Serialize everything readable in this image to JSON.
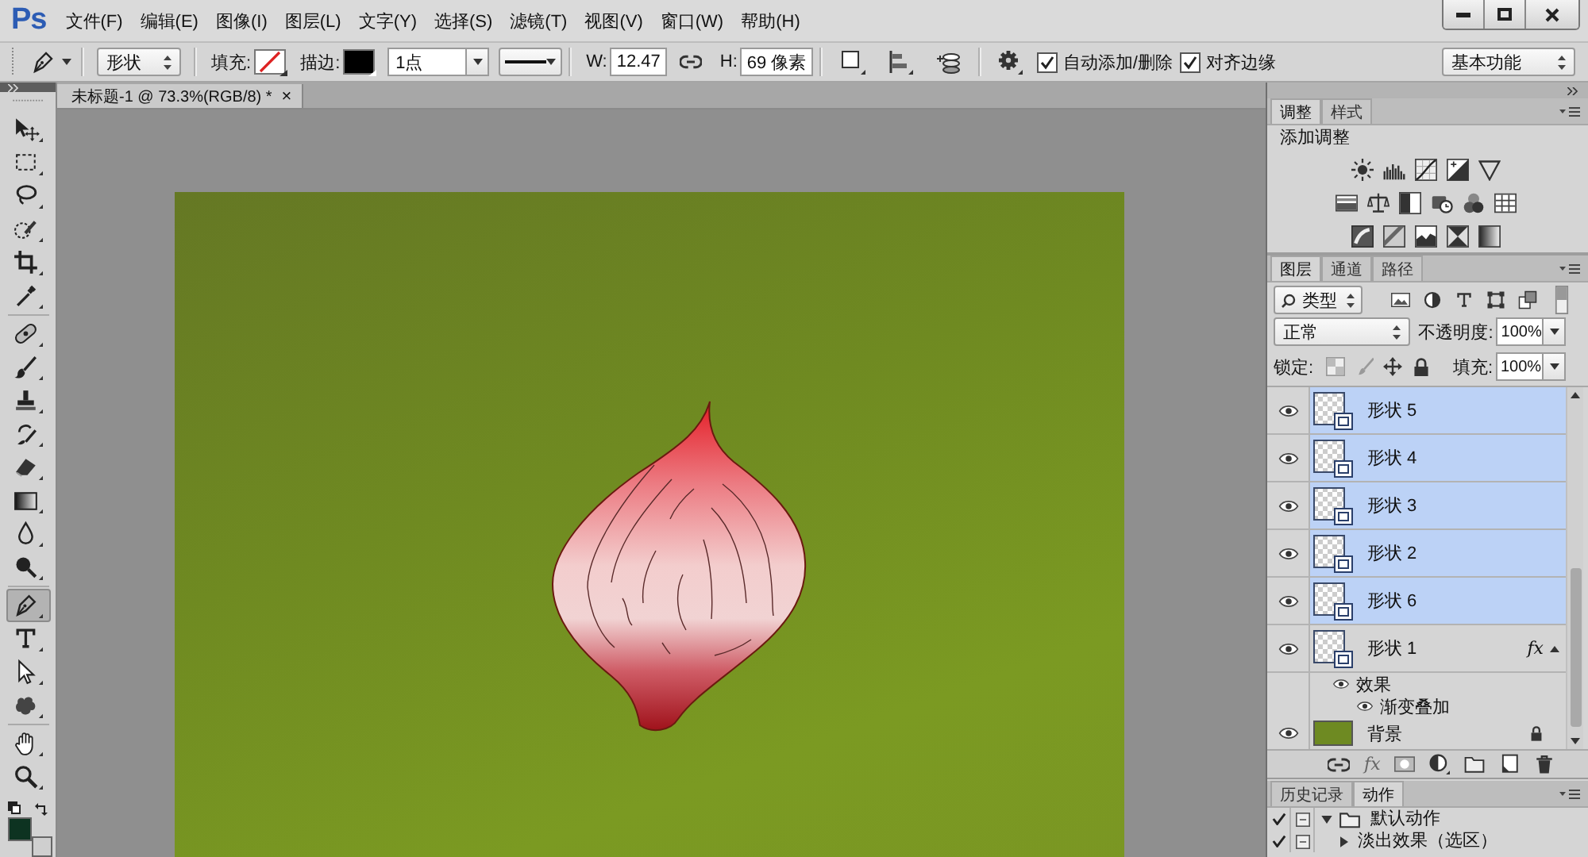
{
  "app": {
    "logo": "Ps"
  },
  "menu": [
    "文件(F)",
    "编辑(E)",
    "图像(I)",
    "图层(L)",
    "文字(Y)",
    "选择(S)",
    "滤镜(T)",
    "视图(V)",
    "窗口(W)",
    "帮助(H)"
  ],
  "options_bar": {
    "mode": "形状",
    "fill_label": "填充:",
    "fill": {
      "kind": "none"
    },
    "stroke_label": "描边:",
    "stroke": {
      "kind": "solid",
      "color": "#000000"
    },
    "stroke_width": "1点",
    "w_label": "W:",
    "w_value": "12.47",
    "h_label": "H:",
    "h_value": "69 像素",
    "checkboxes": [
      {
        "label": "自动添加/删除",
        "checked": true
      },
      {
        "label": "对齐边缘",
        "checked": true
      }
    ],
    "workspace": "基本功能"
  },
  "document_tab": {
    "title": "未标题-1 @ 73.3%(RGB/8) *",
    "close": "×"
  },
  "tools": [
    {
      "kind": "move",
      "selected": false
    },
    {
      "kind": "marquee",
      "selected": false
    },
    {
      "kind": "lasso",
      "selected": false
    },
    {
      "kind": "quick_select",
      "selected": false
    },
    {
      "kind": "crop",
      "selected": false
    },
    {
      "kind": "eyedropper",
      "selected": false
    },
    {
      "kind": "healing",
      "selected": false
    },
    {
      "kind": "brush",
      "selected": false
    },
    {
      "kind": "stamp",
      "selected": false
    },
    {
      "kind": "history_brush",
      "selected": false
    },
    {
      "kind": "eraser",
      "selected": false
    },
    {
      "kind": "gradient",
      "selected": false
    },
    {
      "kind": "blur",
      "selected": false
    },
    {
      "kind": "dodge",
      "selected": false
    },
    {
      "kind": "pen",
      "selected": true
    },
    {
      "kind": "type",
      "selected": false
    },
    {
      "kind": "path_select",
      "selected": false
    },
    {
      "kind": "custom_shape",
      "selected": false
    },
    {
      "kind": "hand",
      "selected": false
    },
    {
      "kind": "zoom",
      "selected": false
    }
  ],
  "colors": [
    {
      "kind": "foreground",
      "color": "#0d3321"
    },
    {
      "kind": "background",
      "color": "#cfcfcf"
    }
  ],
  "adjustments_panel": {
    "tabs": [
      {
        "label": "调整",
        "selected": true
      },
      {
        "label": "样式",
        "selected": false
      }
    ],
    "heading": "添加调整"
  },
  "layers_panel": {
    "tabs": [
      {
        "label": "图层",
        "selected": true
      },
      {
        "label": "通道",
        "selected": false
      },
      {
        "label": "路径",
        "selected": false
      }
    ],
    "filter": "类型",
    "blend_mode": "正常",
    "opacity_label": "不透明度:",
    "opacity": "100%",
    "lock_label": "锁定:",
    "fill_label": "填充:",
    "fill": "100%",
    "layers": [
      {
        "name": "形状 5",
        "kind": "shape",
        "visible": true,
        "selected": true
      },
      {
        "name": "形状 4",
        "kind": "shape",
        "visible": true,
        "selected": true
      },
      {
        "name": "形状 3",
        "kind": "shape",
        "visible": true,
        "selected": true
      },
      {
        "name": "形状 2",
        "kind": "shape",
        "visible": true,
        "selected": true
      },
      {
        "name": "形状 6",
        "kind": "shape",
        "visible": true,
        "selected": true
      },
      {
        "name": "形状 1",
        "kind": "shape",
        "visible": true,
        "selected": false,
        "fx": "fx",
        "expanded": true,
        "effects": [
          {
            "name": "效果",
            "visible": true,
            "children": [
              {
                "name": "渐变叠加",
                "visible": true
              }
            ]
          }
        ]
      },
      {
        "name": "背景",
        "kind": "background",
        "visible": true,
        "selected": false,
        "locked": true
      }
    ],
    "fx_button": "fx"
  },
  "actions_panel": {
    "tabs": [
      {
        "label": "历史记录",
        "selected": false
      },
      {
        "label": "动作",
        "selected": true
      }
    ],
    "items": [
      {
        "name": "默认动作",
        "enabled": true,
        "expanded": true,
        "children": [
          {
            "name": "淡出效果（选区）",
            "enabled": true,
            "expanded": false
          }
        ]
      }
    ]
  }
}
